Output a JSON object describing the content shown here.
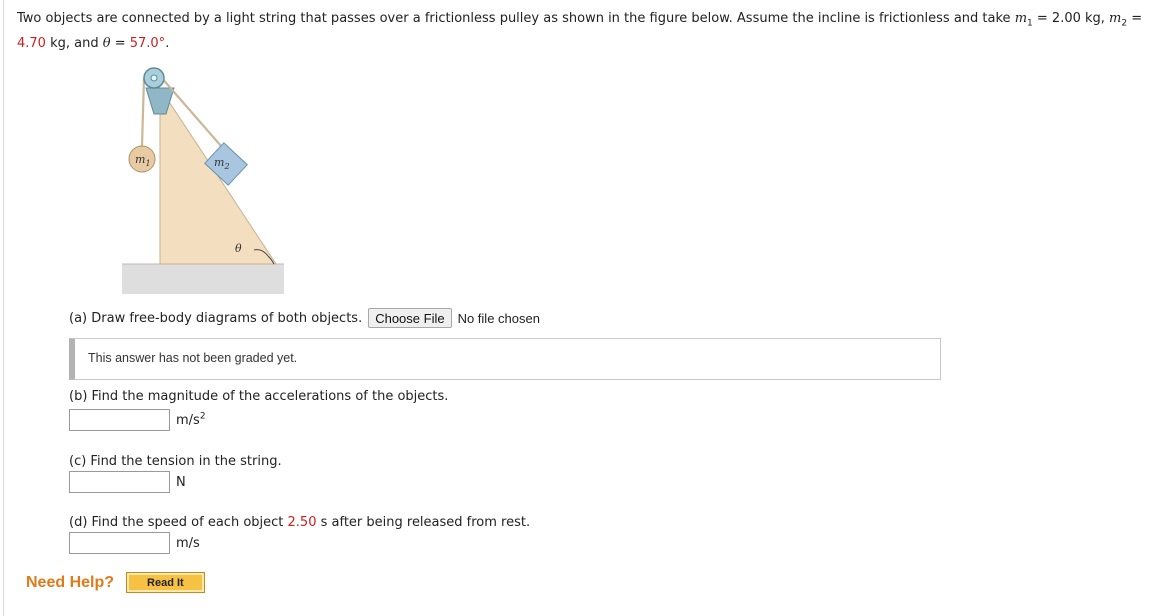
{
  "problem": {
    "intro": "Two objects are connected by a light string that passes over a frictionless pulley as shown in the figure below. Assume the incline is frictionless and take ",
    "m1_sym": "m",
    "m1_sub": "1",
    "eq1": " = ",
    "m1_value": "2.00 kg",
    "sep1": ", ",
    "m2_sym": "m",
    "m2_sub": "2",
    "eq2": " = ",
    "m2_value": "4.70",
    "m2_unit": " kg",
    "sep2": ", and ",
    "theta_sym": "θ",
    "eq3": " = ",
    "theta_value": "57.0°",
    "period": "."
  },
  "figure": {
    "m1_label": "m",
    "m1_sub": "1",
    "m2_label": "m",
    "m2_sub": "2",
    "theta_label": "θ",
    "colors": {
      "incline": "#f3dfc0",
      "block": "#a9c6e0",
      "ball": "#e9cba3",
      "ground": "#dedede"
    }
  },
  "part_a": {
    "question": "(a) Draw free-body diagrams of both objects.",
    "file_button": "Choose File",
    "file_status": "No file chosen",
    "graded_note": "This answer has not been graded yet."
  },
  "part_b": {
    "question": "(b) Find the magnitude of the accelerations of the objects.",
    "answer": "",
    "unit_base": "m/s",
    "unit_exp": "2"
  },
  "part_c": {
    "question": "(c) Find the tension in the string.",
    "answer": "",
    "unit": "N"
  },
  "part_d": {
    "question_pre": "(d) Find the speed of each object ",
    "time_value": "2.50",
    "question_post": " s after being released from rest.",
    "answer": "",
    "unit": "m/s"
  },
  "help": {
    "label": "Need Help?",
    "read_button": "Read It"
  },
  "colors": {
    "given_value": "#cc1f1f",
    "help": "#e07a1a",
    "read_button": "#f6c244"
  }
}
